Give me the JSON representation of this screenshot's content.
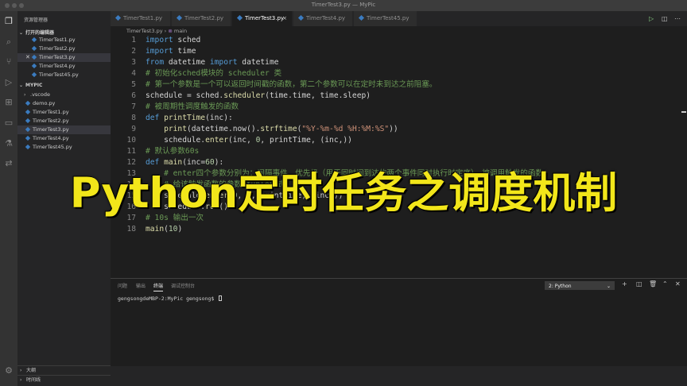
{
  "window": {
    "title": "TimerTest3.py — MyPic"
  },
  "sidebar": {
    "header": "资源管理器",
    "open_editors_title": "打开的编辑器",
    "open_editors": [
      "TimerTest1.py",
      "TimerTest2.py",
      "TimerTest3.py",
      "TimerTest4.py",
      "TimerTest45.py"
    ],
    "close_mark": "✕",
    "folder_title": "MYPIC",
    "folder_items": [
      ".vscode",
      "demo.py",
      "TimerTest1.py",
      "TimerTest2.py",
      "TimerTest3.py",
      "TimerTest4.py",
      "TimerTest45.py"
    ],
    "outline_title": "大纲",
    "timeline_title": "时间线"
  },
  "tabs": [
    {
      "label": "TimerTest1.py"
    },
    {
      "label": "TimerTest2.py"
    },
    {
      "label": "TimerTest3.py",
      "close": "×"
    },
    {
      "label": "TimerTest4.py"
    },
    {
      "label": "TimerTest45.py"
    }
  ],
  "breadcrumb": {
    "file": "TimerTest3.py",
    "sep": "›",
    "symbol": "main"
  },
  "editor": {
    "line_numbers": [
      "1",
      "2",
      "3",
      "4",
      "5",
      "6",
      "7",
      "8",
      "9",
      "10",
      "11",
      "12",
      "13",
      "14",
      "15",
      "16",
      "17",
      "18"
    ],
    "lines": {
      "l1a": "import",
      "l1b": " sched",
      "l2a": "import",
      "l2b": " time",
      "l3a": "from",
      "l3b": " datetime ",
      "l3c": "import",
      "l3d": " datetime",
      "l4": "# 初始化sched模块的 scheduler 类",
      "l5": "# 第一个参数是一个可以返回时间戳的函数，第二个参数可以在定时未到达之前阻塞。",
      "l6a": "schedule = sched.",
      "l6b": "scheduler",
      "l6c": "(time.time, time.sleep)",
      "l7": "# 被周期性调度触发的函数",
      "l8a": "def",
      "l8b": " printTime",
      "l8c": "(inc):",
      "l9a": "    print",
      "l9b": "(datetime.now().",
      "l9c": "strftime",
      "l9d": "(",
      "l9e": "\"%Y-%m-%d %H:%M:%S\"",
      "l9f": "))",
      "l10a": "    schedule.",
      "l10b": "enter",
      "l10c": "(inc, ",
      "l10d": "0",
      "l10e": ", printTime, (inc,))",
      "l11": "# 默认参数60s",
      "l12a": "def",
      "l12b": " main",
      "l12c": "(inc=",
      "l12d": "60",
      "l12e": "):",
      "l13": "    # enter四个参数分别为：间隔事件、优先级（用于同时间到达的两个事件同时执行时定序）、被调用触发的函数,",
      "l14": "    # 给该触发函数的参数(tuple形式)",
      "l15a": "    schedule.",
      "l15b": "enter",
      "l15c": "(",
      "l15d": "0",
      "l15e": ", ",
      "l15f": "0",
      "l15g": ", printTime, (inc,))",
      "l16a": "    schedule.",
      "l16b": "run",
      "l16c": "()",
      "l17": "# 10s 输出一次",
      "l18a": "main",
      "l18b": "(",
      "l18c": "10",
      "l18d": ")"
    }
  },
  "overlay_title": "Python定时任务之调度机制",
  "panel": {
    "tabs": [
      "问题",
      "输出",
      "终端",
      "调试控制台"
    ],
    "terminal_select": "2: Python",
    "terminal_line": "gengsongdeMBP-2:MyPic gengsong$ "
  },
  "colors": {
    "overlay_text": "#f2e61a",
    "editor_bg": "#1e1e1e",
    "sidebar_bg": "#252526",
    "activity_bg": "#333333",
    "keyword": "#569cd6",
    "comment": "#6a9955",
    "string": "#ce9178"
  }
}
